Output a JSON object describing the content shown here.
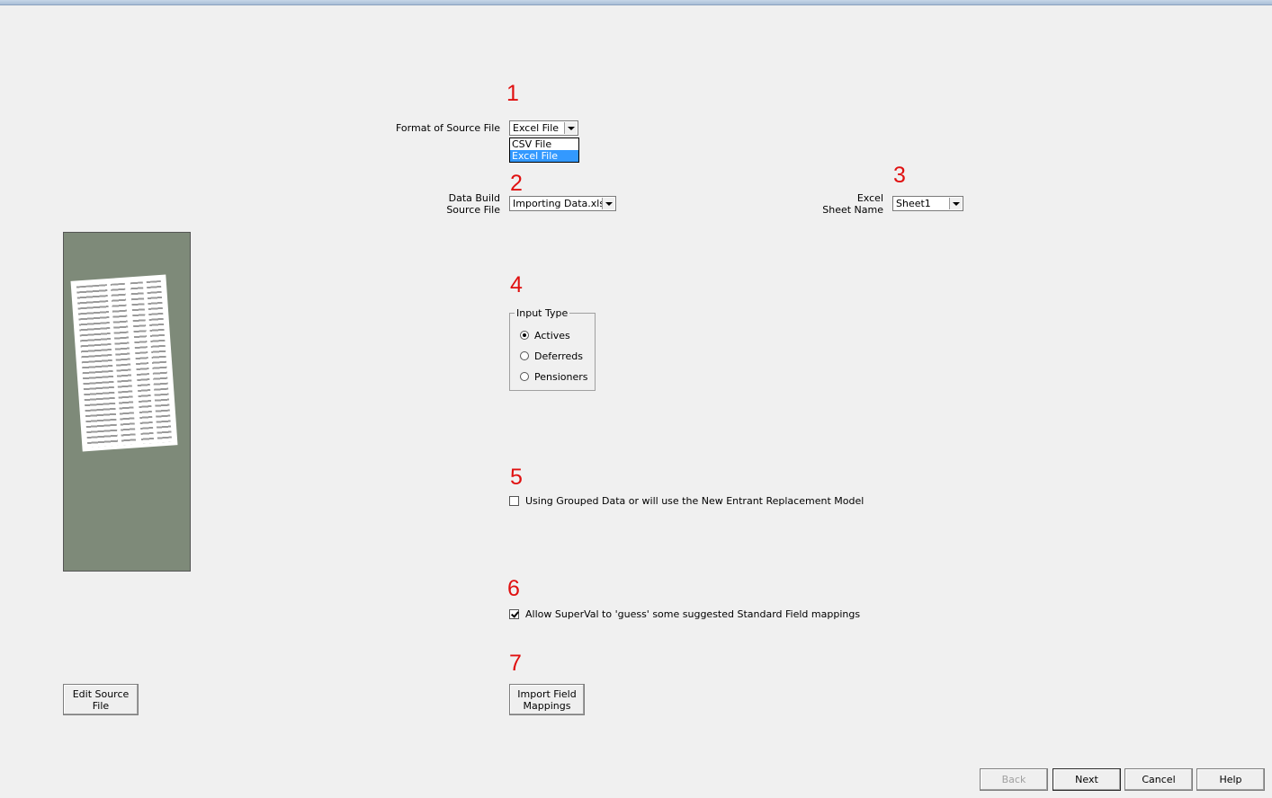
{
  "steps": [
    "1",
    "2",
    "3",
    "4",
    "5",
    "6",
    "7"
  ],
  "format": {
    "label": "Format of Source File",
    "value": "Excel File",
    "options": [
      "CSV File",
      "Excel File"
    ],
    "selected": "Excel File"
  },
  "source": {
    "label_line1": "Data Build",
    "label_line2": "Source File",
    "value": "Importing Data.xlsx"
  },
  "sheet": {
    "label_line1": "Excel",
    "label_line2": "Sheet Name",
    "value": "Sheet1"
  },
  "input_type": {
    "legend": "Input Type",
    "options": [
      "Actives",
      "Deferreds",
      "Pensioners"
    ],
    "selected": "Actives"
  },
  "grouped": {
    "label": "Using Grouped Data or will use the New Entrant Replacement Model",
    "checked": false
  },
  "guess": {
    "label": "Allow SuperVal to 'guess' some suggested Standard Field mappings",
    "checked": true
  },
  "buttons": {
    "edit_source_line1": "Edit Source",
    "edit_source_line2": "File",
    "import_mappings_line1": "Import Field",
    "import_mappings_line2": "Mappings",
    "back": "Back",
    "next": "Next",
    "cancel": "Cancel",
    "help": "Help"
  },
  "colors": {
    "step_number": "#e01010",
    "selection": "#3399ff",
    "preview_bg": "#7e8a79"
  }
}
